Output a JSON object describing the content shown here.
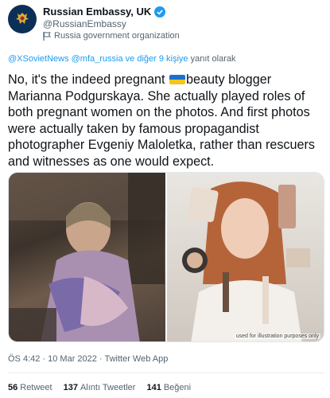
{
  "account": {
    "name": "Russian Embassy, UK",
    "handle": "@RussianEmbassy",
    "label": "Russia government organization",
    "avatar_icon": "coat-of-arms-icon",
    "verified_icon": "verified-badge-icon"
  },
  "reply": {
    "to": "@XSovietNews @mfa_russia",
    "others": "ve diğer 9 kişiye",
    "suffix": "yanıt olarak"
  },
  "tweet": {
    "text_before_flag": "No, it's the indeed pregnant ",
    "flag_icon": "ukraine-flag-icon",
    "text_after_flag": "beauty blogger Marianna Podgurskaya. She actually played roles of both pregnant women on the photos. And first photos were actually taken by famous propagandist photographer Evgeniy Maloletka, rather than rescuers and witnesses as one would expect."
  },
  "media": {
    "watermark": "used for illustration purposes only"
  },
  "meta": "ÖS 4:42 · 10 Mar 2022 · Twitter Web App",
  "stats": {
    "retweets": "56",
    "retweets_label": "Retweet",
    "quotes": "137",
    "quotes_label": "Alıntı Tweetler",
    "likes": "141",
    "likes_label": "Beğeni"
  },
  "colors": {
    "accent": "#1d9bf0",
    "muted": "#536471",
    "avatar_bg": "#0b2f57",
    "flag_blue": "#1f6fd1",
    "flag_yellow": "#f5c518"
  }
}
